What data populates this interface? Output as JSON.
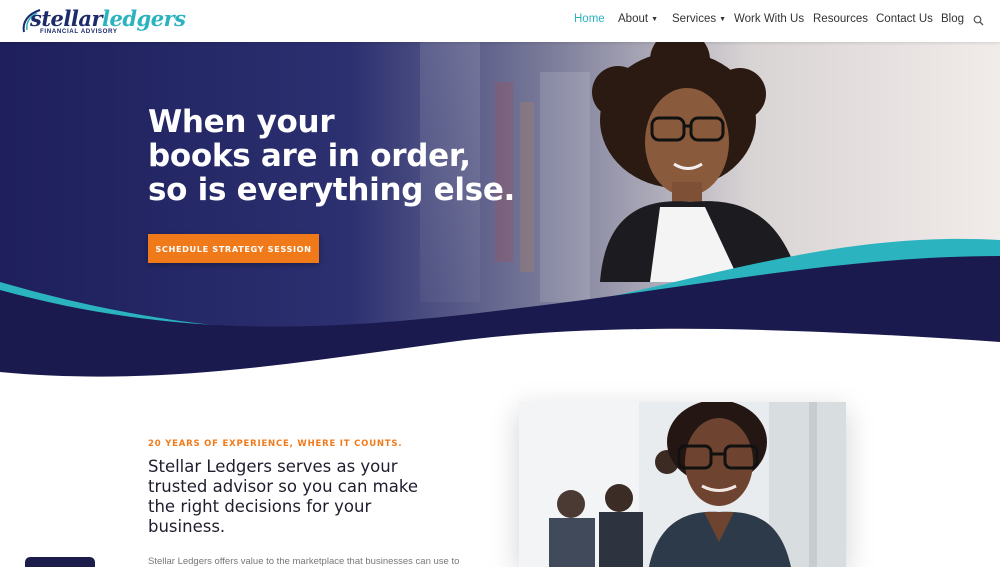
{
  "header": {
    "logo": {
      "word1": "stellar",
      "word2": "ledgers",
      "tagline": "FINANCIAL ADVISORY"
    },
    "nav": [
      {
        "label": "Home",
        "active": true,
        "dropdown": false
      },
      {
        "label": "About",
        "active": false,
        "dropdown": true
      },
      {
        "label": "Services",
        "active": false,
        "dropdown": true
      },
      {
        "label": "Work With Us",
        "active": false,
        "dropdown": false
      },
      {
        "label": "Resources",
        "active": false,
        "dropdown": false
      },
      {
        "label": "Contact Us",
        "active": false,
        "dropdown": false
      },
      {
        "label": "Blog",
        "active": false,
        "dropdown": false
      }
    ],
    "search_icon": "search-icon"
  },
  "hero": {
    "headline": [
      "When your",
      "books are in order,",
      "so is everything else."
    ],
    "cta_label": "SCHEDULE STRATEGY SESSION"
  },
  "intro": {
    "kicker": "20 YEARS OF EXPERIENCE, WHERE IT COUNTS.",
    "subhead": [
      "Stellar Ledgers serves as your",
      "trusted advisor so you can make",
      "the right decisions for your",
      "business."
    ],
    "body_partial": "Stellar Ledgers offers value to the marketplace that businesses can use to"
  },
  "colors": {
    "navy": "#1a1a4e",
    "teal": "#2bb3c0",
    "orange": "#f07a1a",
    "nav_active": "#2bb3c0"
  }
}
